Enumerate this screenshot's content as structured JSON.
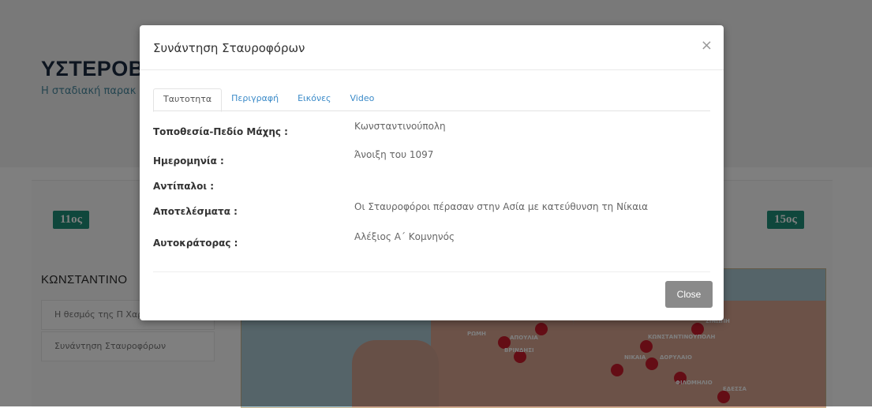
{
  "background": {
    "title": "ΥΣΤΕΡΟΒΥΖ",
    "subtitle": "Η σταδιακή παρακ",
    "century_left": "11ος",
    "century_right": "15ος",
    "section_title": "ΚΩΝΣΤΑΝΤΙΝΟ",
    "list_items": [
      "Η θεσμός της Π Χαριστίκιου",
      "Συνάντηση Σταυροφόρων"
    ],
    "map_labels": [
      "ΡΩΜΗ",
      "ΑΠΟΥΛΙΑ",
      "ΒΡΙΝΔΗΣΙ",
      "ΚΩΝΣΤΑΝΤΙΝΟΥΠΟΛΗ",
      "ΝΙΚΑΙΑ",
      "ΔΟΡΥΛΑΙΟ",
      "ΦΙΛΟΜΗΛΙΟ",
      "ΣΙΝΩΠΗ",
      "ΕΔΕΣΣΑ"
    ]
  },
  "modal": {
    "title": "Συνάντηση Σταυροφόρων",
    "close_symbol": "×",
    "tabs": [
      "Ταυτοτητα",
      "Περιγραφή",
      "Εικόνες",
      "Video"
    ],
    "fields": [
      {
        "label": "Τοποθεσία-Πεδίο Μάχης :",
        "value": "Κωνσταντινούπολη"
      },
      {
        "label": "Ημερομηνία :",
        "value": "Άνοιξη του 1097"
      },
      {
        "label": "Αντίπαλοι :",
        "value": ""
      },
      {
        "label": "Αποτελέσματα :",
        "value": "Οι Σταυροφόροι πέρασαν στην Ασία με κατεύθυνση τη Νίκαια"
      },
      {
        "label": "Αυτοκράτορας :",
        "value": "Αλέξιος Α΄ Κομνηνός"
      }
    ],
    "close_button": "Close"
  }
}
